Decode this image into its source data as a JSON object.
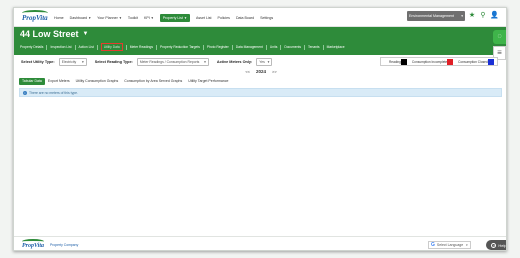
{
  "brand": {
    "logo_text": "PropVita",
    "footer_company": "Property Company"
  },
  "topnav": {
    "items": [
      {
        "label": "Home",
        "dropdown": false
      },
      {
        "label": "Dashboard",
        "dropdown": true
      },
      {
        "label": "Your Planner",
        "dropdown": true
      },
      {
        "label": "Toolkit",
        "dropdown": false
      },
      {
        "label": "KPI",
        "dropdown": true
      },
      {
        "label": "Property List",
        "dropdown": true,
        "active": true
      },
      {
        "label": "Asset List",
        "dropdown": false
      },
      {
        "label": "Policies",
        "dropdown": false
      },
      {
        "label": "Data Board",
        "dropdown": false
      },
      {
        "label": "Settings",
        "dropdown": false
      }
    ],
    "org_select": "Environmental Management"
  },
  "property": {
    "title": "44 Low Street",
    "subnav": [
      "Property Details",
      "Inspection List",
      "Action List",
      "Utility Data",
      "Meter Readings",
      "Property Reduction Targets",
      "Photo Register",
      "Data Management",
      "Units",
      "Documents",
      "Tenants",
      "Marketplace"
    ],
    "active_subnav_index": 3
  },
  "filters": {
    "utility_type_label": "Select Utility Type:",
    "utility_type_value": "Electricity",
    "reading_type_label": "Select Reading Type:",
    "reading_type_value": "Meter Readings / Consumption Reports",
    "active_meters_label": "Active Meters Only:",
    "active_meters_value": "Yes"
  },
  "legend": [
    {
      "label": "Reading",
      "color": "#000000"
    },
    {
      "label": "Consumption Incomplete",
      "color": "#e01f26"
    },
    {
      "label": "Consumption Closed",
      "color": "#1a2fd6"
    }
  ],
  "year": {
    "prev": "<<",
    "value": "2024",
    "next": ">>"
  },
  "tabs": [
    {
      "label": "Tabular Data",
      "active": true
    },
    {
      "label": "Export Meters",
      "active": false
    },
    {
      "label": "Utility Consumption Graphs",
      "active": false
    },
    {
      "label": "Consumption by Area Served Graphs",
      "active": false
    },
    {
      "label": "Utility Target Performance",
      "active": false
    }
  ],
  "info": {
    "message": "There are no meters of this type."
  },
  "footer": {
    "language": "Select Language",
    "help": "Help"
  }
}
